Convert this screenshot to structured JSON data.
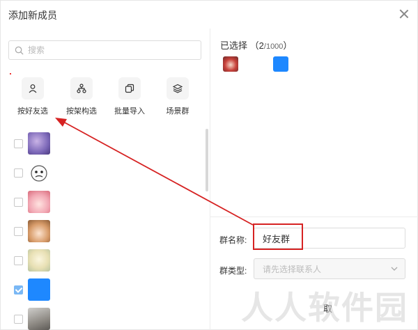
{
  "dialog": {
    "title": "添加新成员"
  },
  "search": {
    "placeholder": "搜索"
  },
  "tools": [
    {
      "label": "按好友选",
      "icon": "person-icon"
    },
    {
      "label": "按架构选",
      "icon": "org-tree-icon"
    },
    {
      "label": "批量导入",
      "icon": "import-icon"
    },
    {
      "label": "场景群",
      "icon": "layers-icon"
    }
  ],
  "members": [
    {
      "checked": false,
      "avatar": "purple-blur-avatar"
    },
    {
      "checked": false,
      "avatar": "meme-face-avatar"
    },
    {
      "checked": false,
      "avatar": "pink-character-avatar"
    },
    {
      "checked": false,
      "avatar": "anime-girl-avatar"
    },
    {
      "checked": false,
      "avatar": "light-anime-avatar"
    },
    {
      "checked": true,
      "avatar": "blue-square-avatar"
    },
    {
      "checked": false,
      "avatar": "gray-photo-avatar"
    }
  ],
  "selected": {
    "label": "已选择",
    "count": "2",
    "total": "/1000",
    "open_paren": "（",
    "close_paren": "）"
  },
  "form": {
    "name_label": "群名称:",
    "name_value": "好友群",
    "type_label": "群类型:",
    "type_placeholder": "请先选择联系人"
  },
  "buttons": {
    "cancel_partial": "取"
  },
  "watermark": "人人软件园",
  "colors": {
    "accent_blue": "#1E88FF",
    "annotation_red": "#D62222",
    "checked_blue": "#7AB8F5"
  }
}
